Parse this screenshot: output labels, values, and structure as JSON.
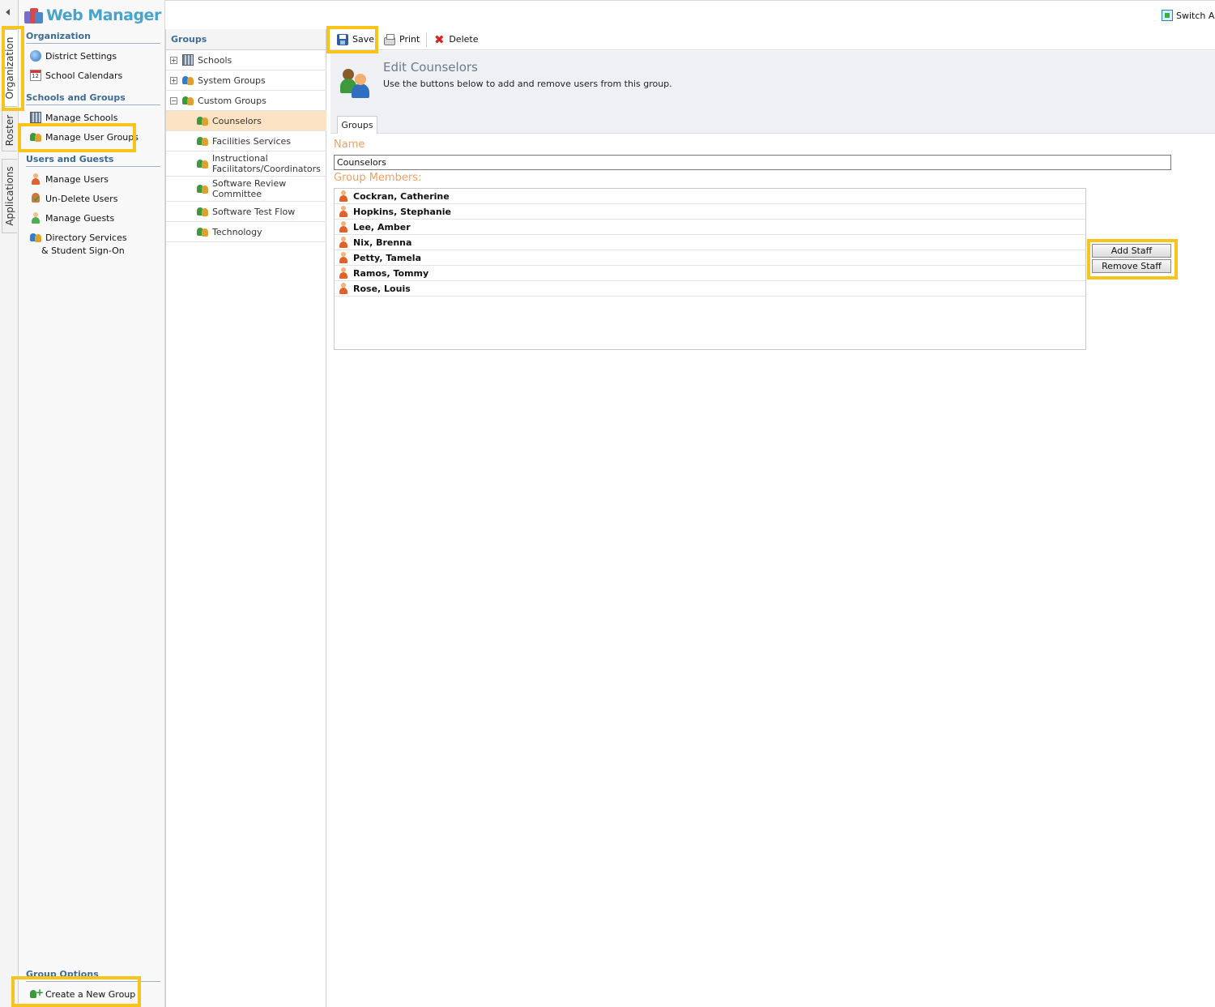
{
  "app": {
    "title": "Web Manager",
    "switch_label": "Switch App"
  },
  "vertical_tabs": [
    {
      "label": "Organization",
      "active": true
    },
    {
      "label": "Roster",
      "active": false
    },
    {
      "label": "Applications",
      "active": false
    }
  ],
  "nav": {
    "sections": {
      "organization": "Organization",
      "schools_groups": "Schools and Groups",
      "users_guests": "Users and Guests",
      "group_options": "Group Options"
    },
    "items": {
      "district_settings": "District Settings",
      "school_calendars": "School Calendars",
      "manage_schools": "Manage Schools",
      "manage_user_groups": "Manage User Groups",
      "manage_users": "Manage Users",
      "undelete_users": "Un-Delete Users",
      "manage_guests": "Manage Guests",
      "directory_services_1": "Directory Services",
      "directory_services_2": "& Student Sign-On",
      "create_group": "Create a New Group"
    }
  },
  "tree": {
    "header": "Groups",
    "nodes": {
      "schools": "Schools",
      "system_groups": "System Groups",
      "custom_groups": "Custom Groups",
      "counselors": "Counselors",
      "facilities": "Facilities Services",
      "instructional_1": "Instructional",
      "instructional_2": "Facilitators/Coordinators",
      "software_review_1": "Software Review",
      "software_review_2": "Committee",
      "software_test": "Software Test Flow",
      "technology": "Technology"
    },
    "expanders": {
      "plus": "+",
      "minus": "−"
    }
  },
  "toolbar": {
    "save": "Save",
    "print": "Print",
    "delete": "Delete"
  },
  "header": {
    "title": "Edit Counselors",
    "description": "Use the buttons below to add and remove users from this group.",
    "tab": "Groups"
  },
  "form": {
    "name_label": "Name",
    "name_value": "Counselors",
    "members_label": "Group Members:",
    "members": [
      "Cockran, Catherine",
      "Hopkins, Stephanie",
      "Lee, Amber",
      "Nix, Brenna",
      "Petty, Tamela",
      "Ramos, Tommy",
      "Rose, Louis"
    ],
    "add_staff": "Add Staff",
    "remove_staff": "Remove Staff"
  },
  "colors": {
    "highlight": "#f9c41a",
    "brand": "#4aa3c8",
    "section": "#3d6b96",
    "form_label": "#f0a060",
    "selected_row": "#fbe3c3"
  }
}
